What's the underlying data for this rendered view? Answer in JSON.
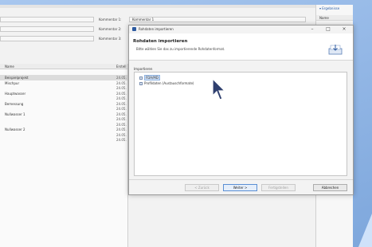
{
  "comments": [
    {
      "label": "Kommentar 1:",
      "value": "Kommentar 1"
    },
    {
      "label": "Kommentar 2:",
      "value": ""
    },
    {
      "label": "Kommentar 3:",
      "value": ""
    }
  ],
  "table": {
    "headers": [
      "Name",
      "Erstell"
    ],
    "rows": [
      {
        "name": "Beispielprojekt",
        "date": "24.05.",
        "selected": true
      },
      {
        "name": "Mischpur",
        "date": "24.05.",
        "selected": false
      },
      {
        "name": "",
        "date": "24.05.",
        "selected": false
      },
      {
        "name": "Hauptwasser",
        "date": "24.05.",
        "selected": false
      },
      {
        "name": "",
        "date": "24.05.",
        "selected": false
      },
      {
        "name": "Bemessung",
        "date": "24.05.",
        "selected": false
      },
      {
        "name": "",
        "date": "24.05.",
        "selected": false
      },
      {
        "name": "Nullwasser 1",
        "date": "24.05.",
        "selected": false
      },
      {
        "name": "",
        "date": "24.05.",
        "selected": false
      },
      {
        "name": "",
        "date": "24.05.",
        "selected": false
      },
      {
        "name": "Nullwasser 2",
        "date": "24.05.",
        "selected": false
      },
      {
        "name": "",
        "date": "24.05.",
        "selected": false
      },
      {
        "name": "",
        "date": "24.05.",
        "selected": false
      }
    ]
  },
  "right_panel": {
    "header": "▾ Ergebnisse",
    "column": "Name"
  },
  "dialog": {
    "title": "Rohdaten importieren",
    "heading": "Rohdaten importieren",
    "description": "Bitte wählen Sie das zu importierende Rohdatenformat.",
    "group_label": "Importieren",
    "items": [
      {
        "label": "FDA/MD",
        "selected": true
      },
      {
        "label": "Profildaten (Austauschformate)",
        "selected": false
      }
    ],
    "buttons": {
      "back": "< Zurück",
      "next": "Weiter >",
      "finish": "Fertigstellen",
      "cancel": "Abbrechen"
    },
    "window_controls": {
      "minimize": "–",
      "maximize": "□",
      "close": "×"
    }
  }
}
